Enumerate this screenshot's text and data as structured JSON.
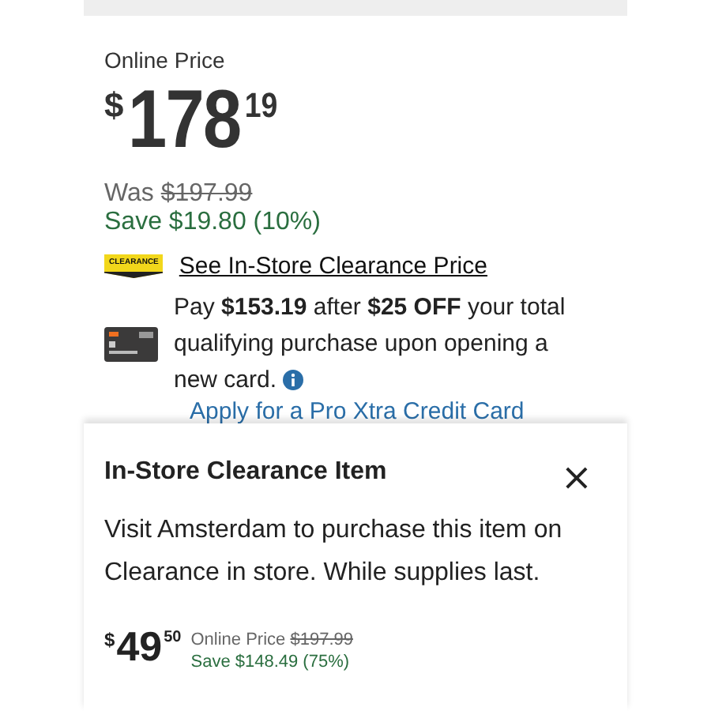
{
  "price_panel": {
    "label": "Online Price",
    "price": {
      "currency": "$",
      "dollars": "178",
      "cents": "19"
    },
    "was_label": "Was",
    "was_price": "$197.99",
    "savings": "Save $19.80 (10%)",
    "clearance": {
      "badge": "CLEARANCE",
      "link": "See In-Store Clearance Price"
    },
    "card_offer": {
      "text": "Pay **$153.19** after **$25 OFF** your total qualifying purchase upon opening a new card.",
      "link": "Apply for a Pro Xtra Credit Card"
    }
  },
  "clearance_sheet": {
    "title": "In-Store Clearance Item",
    "close": "×",
    "message": "Visit Amsterdam to purchase this item on Clearance in store. While supplies last.",
    "price": {
      "currency": "$",
      "dollars": "49",
      "cents": "50"
    },
    "online_label": "Online Price",
    "online_price": "$197.99",
    "savings": "Save $148.49 (75%)"
  }
}
